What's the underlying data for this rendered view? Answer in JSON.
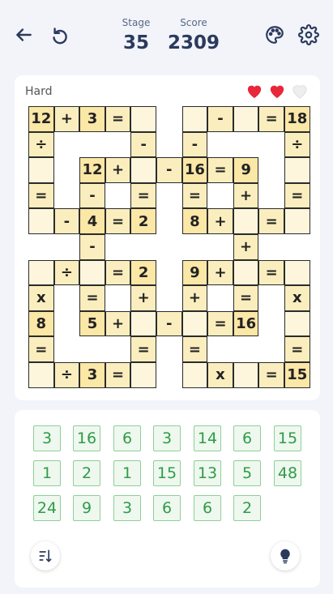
{
  "header": {
    "stage_label": "Stage",
    "stage_value": "35",
    "score_label": "Score",
    "score_value": "2309"
  },
  "board": {
    "difficulty": "Hard",
    "hearts": [
      "full",
      "full",
      "empty"
    ],
    "cells": [
      {
        "r": 0,
        "c": 0,
        "t": "12",
        "k": "num"
      },
      {
        "r": 0,
        "c": 1,
        "t": "+",
        "k": "op"
      },
      {
        "r": 0,
        "c": 2,
        "t": "3",
        "k": "num"
      },
      {
        "r": 0,
        "c": 3,
        "t": "=",
        "k": "op"
      },
      {
        "r": 0,
        "c": 4,
        "t": "",
        "k": "empty"
      },
      {
        "r": 0,
        "c": 6,
        "t": "",
        "k": "empty"
      },
      {
        "r": 0,
        "c": 7,
        "t": "-",
        "k": "op"
      },
      {
        "r": 0,
        "c": 8,
        "t": "",
        "k": "empty"
      },
      {
        "r": 0,
        "c": 9,
        "t": "=",
        "k": "op"
      },
      {
        "r": 0,
        "c": 10,
        "t": "18",
        "k": "num"
      },
      {
        "r": 1,
        "c": 0,
        "t": "÷",
        "k": "op"
      },
      {
        "r": 1,
        "c": 4,
        "t": "-",
        "k": "op"
      },
      {
        "r": 1,
        "c": 6,
        "t": "-",
        "k": "op"
      },
      {
        "r": 1,
        "c": 10,
        "t": "÷",
        "k": "op"
      },
      {
        "r": 2,
        "c": 0,
        "t": "",
        "k": "empty"
      },
      {
        "r": 2,
        "c": 2,
        "t": "12",
        "k": "num"
      },
      {
        "r": 2,
        "c": 3,
        "t": "+",
        "k": "op"
      },
      {
        "r": 2,
        "c": 4,
        "t": "",
        "k": "empty"
      },
      {
        "r": 2,
        "c": 5,
        "t": "-",
        "k": "op"
      },
      {
        "r": 2,
        "c": 6,
        "t": "16",
        "k": "num"
      },
      {
        "r": 2,
        "c": 7,
        "t": "=",
        "k": "op"
      },
      {
        "r": 2,
        "c": 8,
        "t": "9",
        "k": "num"
      },
      {
        "r": 2,
        "c": 10,
        "t": "",
        "k": "empty"
      },
      {
        "r": 3,
        "c": 0,
        "t": "=",
        "k": "op"
      },
      {
        "r": 3,
        "c": 2,
        "t": "-",
        "k": "op"
      },
      {
        "r": 3,
        "c": 4,
        "t": "=",
        "k": "op"
      },
      {
        "r": 3,
        "c": 6,
        "t": "=",
        "k": "op"
      },
      {
        "r": 3,
        "c": 8,
        "t": "+",
        "k": "op"
      },
      {
        "r": 3,
        "c": 10,
        "t": "=",
        "k": "op"
      },
      {
        "r": 4,
        "c": 0,
        "t": "",
        "k": "empty"
      },
      {
        "r": 4,
        "c": 1,
        "t": "-",
        "k": "op"
      },
      {
        "r": 4,
        "c": 2,
        "t": "4",
        "k": "num"
      },
      {
        "r": 4,
        "c": 3,
        "t": "=",
        "k": "op"
      },
      {
        "r": 4,
        "c": 4,
        "t": "2",
        "k": "num"
      },
      {
        "r": 4,
        "c": 6,
        "t": "8",
        "k": "num"
      },
      {
        "r": 4,
        "c": 7,
        "t": "+",
        "k": "op"
      },
      {
        "r": 4,
        "c": 8,
        "t": "",
        "k": "empty"
      },
      {
        "r": 4,
        "c": 9,
        "t": "=",
        "k": "op"
      },
      {
        "r": 4,
        "c": 10,
        "t": "",
        "k": "empty"
      },
      {
        "r": 5,
        "c": 2,
        "t": "-",
        "k": "op"
      },
      {
        "r": 5,
        "c": 8,
        "t": "+",
        "k": "op"
      },
      {
        "r": 6,
        "c": 0,
        "t": "",
        "k": "empty"
      },
      {
        "r": 6,
        "c": 1,
        "t": "÷",
        "k": "op"
      },
      {
        "r": 6,
        "c": 2,
        "t": "",
        "k": "empty"
      },
      {
        "r": 6,
        "c": 3,
        "t": "=",
        "k": "op"
      },
      {
        "r": 6,
        "c": 4,
        "t": "2",
        "k": "num"
      },
      {
        "r": 6,
        "c": 6,
        "t": "9",
        "k": "num"
      },
      {
        "r": 6,
        "c": 7,
        "t": "+",
        "k": "op"
      },
      {
        "r": 6,
        "c": 8,
        "t": "",
        "k": "empty"
      },
      {
        "r": 6,
        "c": 9,
        "t": "=",
        "k": "op"
      },
      {
        "r": 6,
        "c": 10,
        "t": "",
        "k": "empty"
      },
      {
        "r": 7,
        "c": 0,
        "t": "x",
        "k": "op"
      },
      {
        "r": 7,
        "c": 2,
        "t": "=",
        "k": "op"
      },
      {
        "r": 7,
        "c": 4,
        "t": "+",
        "k": "op"
      },
      {
        "r": 7,
        "c": 6,
        "t": "+",
        "k": "op"
      },
      {
        "r": 7,
        "c": 8,
        "t": "=",
        "k": "op"
      },
      {
        "r": 7,
        "c": 10,
        "t": "x",
        "k": "op"
      },
      {
        "r": 8,
        "c": 0,
        "t": "8",
        "k": "num"
      },
      {
        "r": 8,
        "c": 2,
        "t": "5",
        "k": "num"
      },
      {
        "r": 8,
        "c": 3,
        "t": "+",
        "k": "op"
      },
      {
        "r": 8,
        "c": 4,
        "t": "",
        "k": "empty"
      },
      {
        "r": 8,
        "c": 5,
        "t": "-",
        "k": "op"
      },
      {
        "r": 8,
        "c": 6,
        "t": "",
        "k": "empty"
      },
      {
        "r": 8,
        "c": 7,
        "t": "=",
        "k": "op"
      },
      {
        "r": 8,
        "c": 8,
        "t": "16",
        "k": "num"
      },
      {
        "r": 8,
        "c": 10,
        "t": "",
        "k": "empty"
      },
      {
        "r": 9,
        "c": 0,
        "t": "=",
        "k": "op"
      },
      {
        "r": 9,
        "c": 4,
        "t": "=",
        "k": "op"
      },
      {
        "r": 9,
        "c": 6,
        "t": "=",
        "k": "op"
      },
      {
        "r": 9,
        "c": 10,
        "t": "=",
        "k": "op"
      },
      {
        "r": 10,
        "c": 0,
        "t": "",
        "k": "empty"
      },
      {
        "r": 10,
        "c": 1,
        "t": "÷",
        "k": "op"
      },
      {
        "r": 10,
        "c": 2,
        "t": "3",
        "k": "num"
      },
      {
        "r": 10,
        "c": 3,
        "t": "=",
        "k": "op"
      },
      {
        "r": 10,
        "c": 4,
        "t": "",
        "k": "empty"
      },
      {
        "r": 10,
        "c": 6,
        "t": "",
        "k": "empty"
      },
      {
        "r": 10,
        "c": 7,
        "t": "x",
        "k": "op"
      },
      {
        "r": 10,
        "c": 8,
        "t": "",
        "k": "empty"
      },
      {
        "r": 10,
        "c": 9,
        "t": "=",
        "k": "op"
      },
      {
        "r": 10,
        "c": 10,
        "t": "15",
        "k": "num"
      }
    ]
  },
  "tray": {
    "tiles": [
      [
        "3",
        "16",
        "6",
        "3",
        "14",
        "6",
        "15"
      ],
      [
        "1",
        "2",
        "1",
        "15",
        "13",
        "5",
        "48"
      ],
      [
        "24",
        "9",
        "3",
        "6",
        "6",
        "2"
      ]
    ]
  },
  "colors": {
    "accent": "#2b3a5c",
    "number_cell": "#fbe7a6",
    "tile_border": "#8fcf97",
    "tile_text": "#2e9c45",
    "heart": "#e8273a"
  }
}
